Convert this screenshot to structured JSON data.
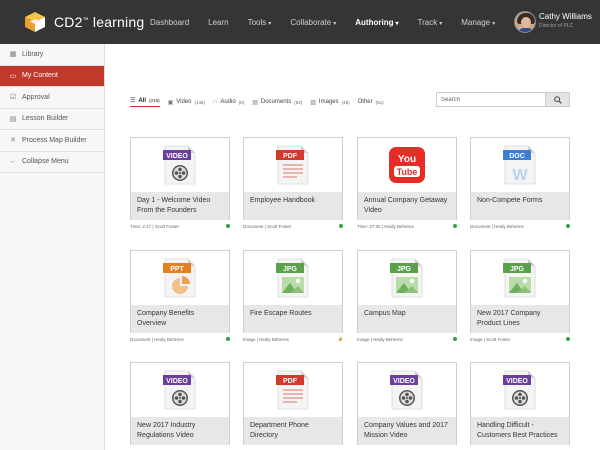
{
  "brand": {
    "name": "CD2",
    "suffix": "™",
    "name2": " learning"
  },
  "nav": [
    {
      "label": "Dashboard",
      "caret": false
    },
    {
      "label": "Learn",
      "caret": false
    },
    {
      "label": "Tools",
      "caret": true
    },
    {
      "label": "Collaborate",
      "caret": true
    },
    {
      "label": "Authoring",
      "caret": true,
      "active": true
    },
    {
      "label": "Track",
      "caret": true
    },
    {
      "label": "Manage",
      "caret": true
    }
  ],
  "user": {
    "name": "Cathy Williams",
    "role": "Director of PLC"
  },
  "sidebar": {
    "items": [
      {
        "label": "Library",
        "icon": "grid-icon"
      },
      {
        "label": "My Content",
        "icon": "folder-icon",
        "active": true
      },
      {
        "label": "Approval",
        "icon": "check-square-icon"
      },
      {
        "label": "Lesson Builder",
        "icon": "document-icon"
      },
      {
        "label": "Process Map Builder",
        "icon": "tools-icon"
      },
      {
        "label": "Collapse Menu",
        "icon": "arrow-left-icon"
      }
    ]
  },
  "tabs": [
    {
      "label": "All",
      "count": "(315)",
      "icon": "list-icon",
      "active": true
    },
    {
      "label": "Video",
      "count": "(146)",
      "icon": "video-icon"
    },
    {
      "label": "Audio",
      "count": "(0)",
      "icon": "headphones-icon"
    },
    {
      "label": "Documents",
      "count": "(63)",
      "icon": "document-icon"
    },
    {
      "label": "Images",
      "count": "(45)",
      "icon": "image-icon"
    },
    {
      "label": "Other",
      "count": "(61)",
      "icon": "none"
    }
  ],
  "search": {
    "placeholder": "Search"
  },
  "cards": [
    {
      "type": "VIDEO",
      "title": "Day 1 - Welcome Video From the Founders",
      "meta": "Time: 2:17 | Scott Foster",
      "status": "published"
    },
    {
      "type": "PDF",
      "title": "Employee Handbook",
      "meta": "Document | Scott Foster",
      "status": "published"
    },
    {
      "type": "YOUTUBE",
      "title": "Annual Company Getaway Video",
      "meta": "Time: 27:25 | Heidy Behrens",
      "status": "published"
    },
    {
      "type": "DOC",
      "title": "Non-Compete Forms",
      "meta": "Document | Heidy Behrens",
      "status": "published"
    },
    {
      "type": "PPT",
      "title": "Company Benefits Overview",
      "meta": "Document | Heidy Behrens",
      "status": "published"
    },
    {
      "type": "JPG",
      "title": "Fire Escape Routes",
      "meta": "Image | Heidy Behrens",
      "status": "locked"
    },
    {
      "type": "JPG",
      "title": "Campus Map",
      "meta": "Image | Heidy Behrens",
      "status": "published"
    },
    {
      "type": "JPG",
      "title": "New 2017 Company Product Lines",
      "meta": "Image | Scott Foster",
      "status": "published"
    },
    {
      "type": "VIDEO",
      "title": "New 2017 Industry Regulations Video",
      "meta": "",
      "status": ""
    },
    {
      "type": "PDF",
      "title": "Department Phone Directory",
      "meta": "",
      "status": ""
    },
    {
      "type": "VIDEO",
      "title": "Company Values and 2017 Mission Video",
      "meta": "",
      "status": ""
    },
    {
      "type": "VIDEO",
      "title": "Handling Difficult - Customers Best Practices",
      "meta": "",
      "status": ""
    }
  ],
  "colors": {
    "topbar": "#333537",
    "accent": "#c0392b",
    "video": "#6b3fa0",
    "pdf": "#d33a2c",
    "doc": "#3a7fd5",
    "ppt": "#e67e22",
    "jpg": "#5ba04a",
    "youtube": "#e52d27",
    "published": "#3aa03a"
  }
}
